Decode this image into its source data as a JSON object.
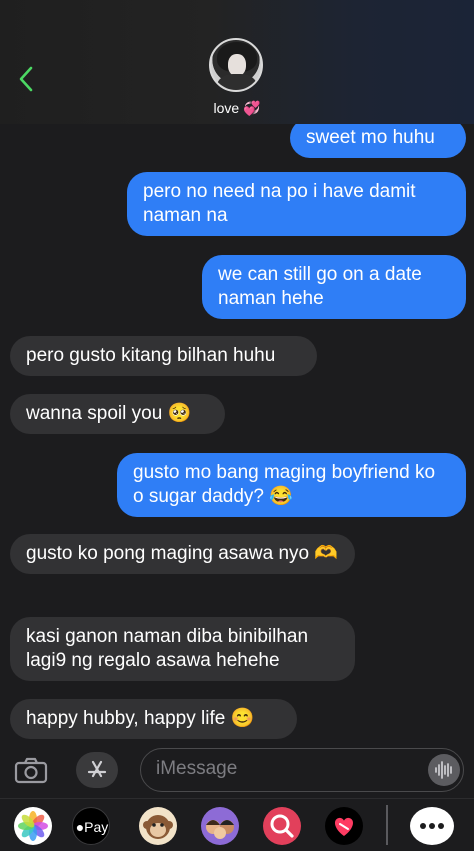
{
  "header": {
    "back_icon": "chevron-left-icon",
    "contact_name": "love 💞"
  },
  "messages": [
    {
      "side": "sent",
      "text": "sweet mo huhu"
    },
    {
      "side": "sent",
      "text": "pero no need na po i have damit naman na"
    },
    {
      "side": "sent",
      "text": "we can still go on a date naman hehe"
    },
    {
      "side": "recv",
      "text": "pero gusto kitang bilhan huhu"
    },
    {
      "side": "recv",
      "text": "wanna spoil you 🥺"
    },
    {
      "side": "sent",
      "text": "gusto mo bang maging boyfriend ko o sugar daddy? 😂"
    },
    {
      "side": "recv",
      "text": "gusto ko pong maging asawa nyo 🫶"
    },
    {
      "side": "recv",
      "text": "kasi ganon naman diba binibilhan lagi9 ng regalo asawa hehehe"
    },
    {
      "side": "recv",
      "text": "happy hubby, happy life 😊"
    }
  ],
  "input": {
    "placeholder": "iMessage",
    "camera_icon": "camera-icon",
    "apps_icon": "app-store-icon",
    "audio_icon": "audio-waveform-icon"
  },
  "app_drawer": {
    "apple_pay_label": "Pay",
    "icons": [
      "photos-icon",
      "apple-pay-icon",
      "animoji-icon",
      "memoji-icon",
      "search-images-icon",
      "heart-app-icon",
      "more-icon"
    ]
  },
  "colors": {
    "sent_bubble": "#2f7ef6",
    "received_bubble": "#323234",
    "background": "#1c1c1e",
    "accent_green": "#4cd964"
  }
}
